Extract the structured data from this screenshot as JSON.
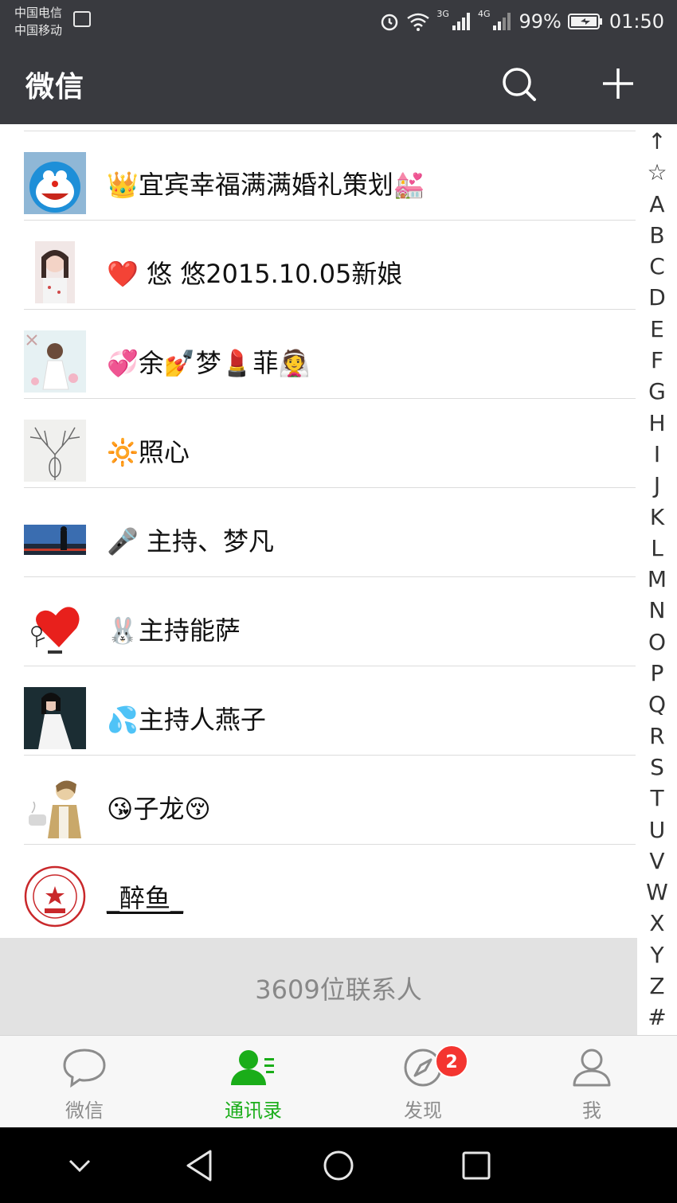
{
  "status_bar": {
    "carrier_1": "中国电信",
    "carrier_2": "中国移动",
    "net_3g": "3G",
    "net_4g": "4G",
    "battery": "99%",
    "time": "01:50"
  },
  "header": {
    "title": "微信",
    "search_icon": "search-icon",
    "add_icon": "plus-icon"
  },
  "contacts": [
    {
      "name": "👑宜宾幸福满满婚礼策划💒"
    },
    {
      "name": "❤️  悠  悠2015.10.05新娘"
    },
    {
      "name": "💞余💅梦💄菲👰"
    },
    {
      "name": "🔆照心"
    },
    {
      "name": "🎤 主持、梦凡"
    },
    {
      "name": "🐰主持能萨"
    },
    {
      "name": "💦主持人燕子"
    },
    {
      "name": "😘子龙😚"
    },
    {
      "name": "_醉鱼_"
    }
  ],
  "index_letters": [
    "↑",
    "☆",
    "A",
    "B",
    "C",
    "D",
    "E",
    "F",
    "G",
    "H",
    "I",
    "J",
    "K",
    "L",
    "M",
    "N",
    "O",
    "P",
    "Q",
    "R",
    "S",
    "T",
    "U",
    "V",
    "W",
    "X",
    "Y",
    "Z",
    "#"
  ],
  "contact_count": "3609位联系人",
  "tabs": [
    {
      "label": "微信",
      "icon": "chat-bubble-icon"
    },
    {
      "label": "通讯录",
      "icon": "contacts-icon"
    },
    {
      "label": "发现",
      "icon": "compass-icon",
      "badge": "2"
    },
    {
      "label": "我",
      "icon": "person-icon"
    }
  ],
  "colors": {
    "header_bg": "#393a3f",
    "active_green": "#1aad19",
    "badge_red": "#f43530"
  }
}
